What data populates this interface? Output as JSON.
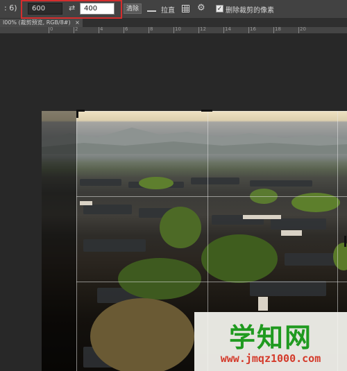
{
  "options_bar": {
    "ratio_suffix": ": 6)",
    "width_value": "600",
    "swap_icon": "swap-arrows-icon",
    "height_value": "400",
    "clear_button": "清除",
    "straighten_label": "拉直",
    "grid_icon": "grid-overlay-icon",
    "gear_icon": "gear-icon",
    "delete_cropped_checked": true,
    "delete_cropped_label": "删除裁剪的像素",
    "highlight_color": "#d42d2d"
  },
  "document_tab": {
    "title": "l00% (裁剪预览, RGB/8#)",
    "close_label": "×"
  },
  "ruler": {
    "labels": [
      "0",
      "2",
      "4",
      "6",
      "8",
      "10",
      "12",
      "14",
      "16",
      "18",
      "20"
    ]
  },
  "watermark": {
    "title": "学知网",
    "url": "www.jmqz1000.com",
    "title_color": "#1f9a1f",
    "url_color": "#d43a2a"
  }
}
